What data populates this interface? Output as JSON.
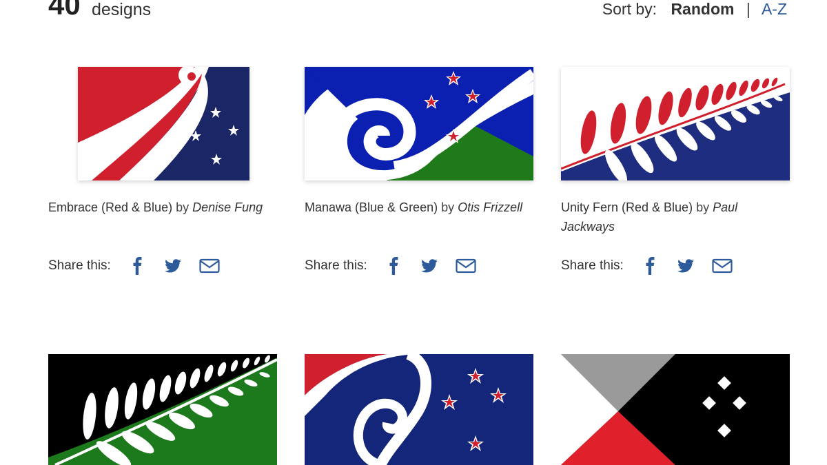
{
  "header": {
    "count": "40",
    "count_label": "designs",
    "sort_label": "Sort by:",
    "sort_active": "Random",
    "sort_separator": "|",
    "sort_alt": "A-Z"
  },
  "share_label": "Share this:",
  "colors": {
    "accent": "#2d5a9a",
    "text": "#333333"
  },
  "designs": [
    {
      "title": "Embrace (Red & Blue)",
      "by": "by",
      "author": "Denise Fung"
    },
    {
      "title": "Manawa (Blue & Green)",
      "by": "by",
      "author": "Otis Frizzell"
    },
    {
      "title": "Unity Fern (Red & Blue)",
      "by": "by",
      "author": "Paul Jackways"
    },
    {
      "title": "",
      "by": "",
      "author": ""
    },
    {
      "title": "",
      "by": "",
      "author": ""
    },
    {
      "title": "",
      "by": "",
      "author": ""
    }
  ],
  "icons": [
    "facebook-icon",
    "twitter-icon",
    "email-icon"
  ]
}
